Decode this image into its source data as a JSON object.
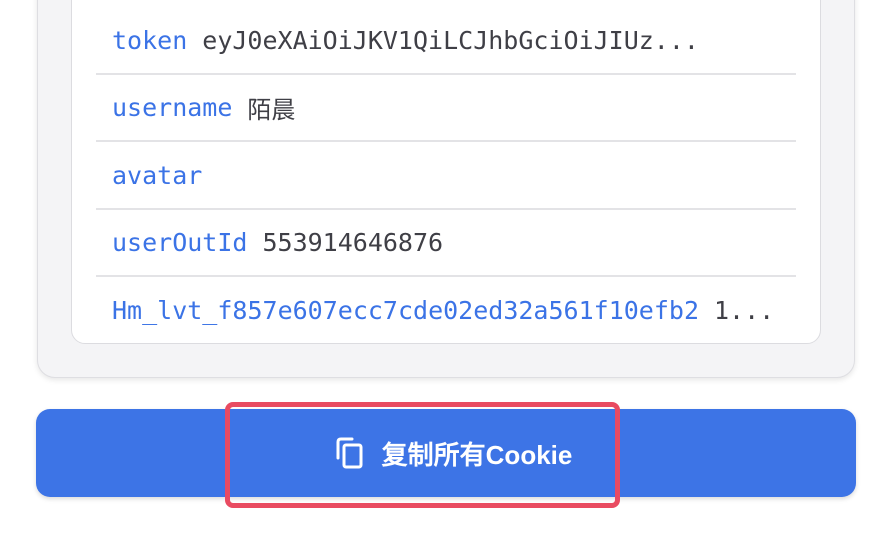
{
  "cookies": [
    {
      "key": "token",
      "value": "eyJ0eXAiOiJKV1QiLCJhbGciOiJIUz..."
    },
    {
      "key": "username",
      "value": "陌晨"
    },
    {
      "key": "avatar",
      "value": ""
    },
    {
      "key": "userOutId",
      "value": "553914646876"
    },
    {
      "key": "Hm_lvt_f857e607ecc7cde02ed32a561f10efb2",
      "value": "1..."
    }
  ],
  "actions": {
    "copy_all_label": "复制所有Cookie",
    "copy_icon": "copy-icon"
  },
  "colors": {
    "accent": "#3d74e6",
    "key_text": "#3b73e6",
    "value_text": "#3f3f46",
    "highlight": "#e94b61"
  }
}
